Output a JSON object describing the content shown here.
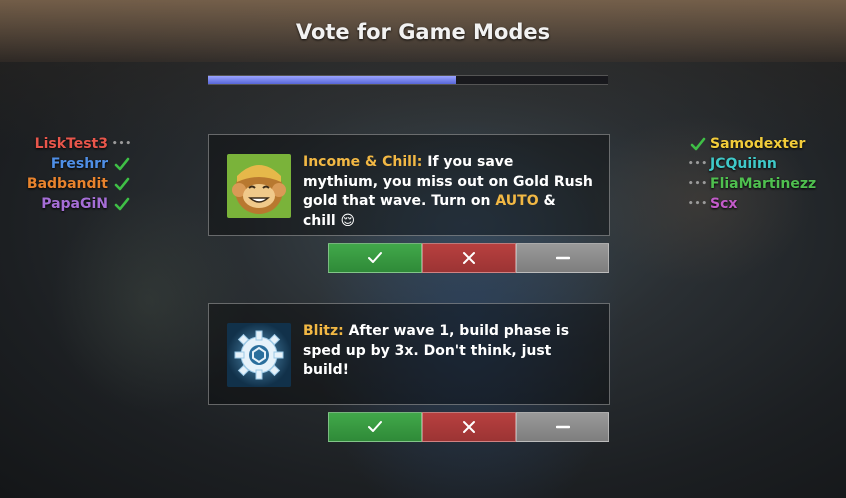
{
  "title": "Vote for Game Modes",
  "progress": 0.62,
  "players_left": [
    {
      "name": "LiskTest3",
      "color": "#e8564b",
      "status": "waiting"
    },
    {
      "name": "Freshrr",
      "color": "#4f8fe6",
      "status": "voted"
    },
    {
      "name": "Badbandit",
      "color": "#e8832d",
      "status": "voted"
    },
    {
      "name": "PapaGiN",
      "color": "#a56ed6",
      "status": "voted"
    }
  ],
  "players_right": [
    {
      "name": "Samodexter",
      "color": "#f2cc3a",
      "status": "voted"
    },
    {
      "name": "JCQuiinn",
      "color": "#3fc9c9",
      "status": "waiting"
    },
    {
      "name": "FliaMartinezz",
      "color": "#4fbf4f",
      "status": "waiting"
    },
    {
      "name": "Scx",
      "color": "#c25bc9",
      "status": "waiting"
    }
  ],
  "modes": [
    {
      "name": "Income & Chill:",
      "desc_part1": " If you save mythium, you miss out on Gold Rush gold that wave. Turn on ",
      "highlight": "AUTO",
      "desc_part2": " & chill ",
      "emoji": "😌",
      "icon": "monkey-icon"
    },
    {
      "name": "Blitz:",
      "desc": " After wave 1, build phase is sped up by 3x. Don't think, just build!",
      "icon": "gear-icon"
    }
  ],
  "vote_buttons": {
    "yes": "check-icon",
    "no": "x-icon",
    "abstain": "dash-icon"
  },
  "colors": {
    "accent": "#f2b844",
    "yes": "#3a9a43",
    "no": "#ad3b3a",
    "abstain": "#8c8c8c"
  }
}
